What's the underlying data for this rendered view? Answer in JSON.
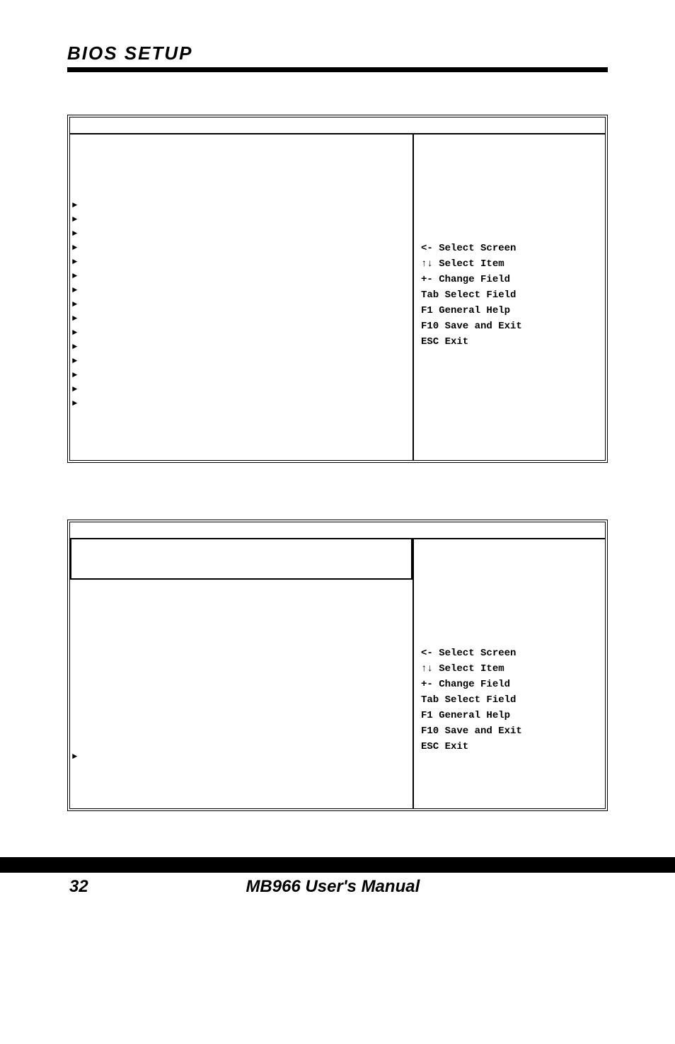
{
  "header": {
    "title": "BIOS SETUP"
  },
  "help": {
    "l1": "<-  Select Screen",
    "l2": "↑↓ Select Item",
    "l3": "+-  Change Field",
    "l4": "Tab Select Field",
    "l5": "F1  General Help",
    "l6": "F10 Save and Exit",
    "l7": "ESC Exit"
  },
  "box1": {
    "arrows": [
      "►",
      "►",
      "►",
      "►",
      "►",
      "►",
      "►",
      "►",
      "►",
      "►",
      "►",
      "►",
      "►",
      "►",
      "►"
    ]
  },
  "box2": {
    "arrows": [
      "►"
    ]
  },
  "footer": {
    "page": "32",
    "title": "MB966 User's Manual"
  }
}
